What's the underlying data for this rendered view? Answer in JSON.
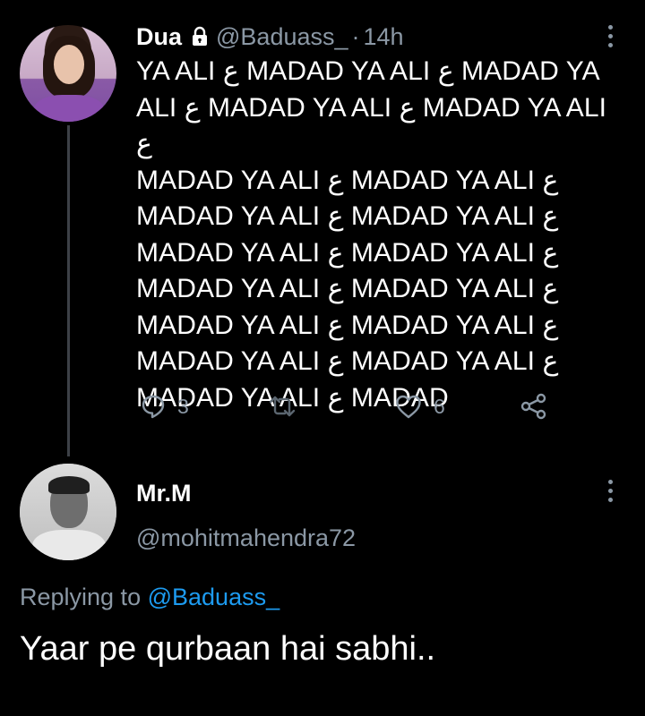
{
  "tweet": {
    "author": {
      "display_name": "Dua",
      "handle": "@Baduass_",
      "protected_icon": "lock-icon",
      "avatar": "avatar"
    },
    "separator": "·",
    "time": "14h",
    "text_lines": [
      "YA ALI ع MADAD YA ALI ع MADAD YA",
      "ALI ع MADAD YA ALI ع MADAD YA ALI ع",
      "MADAD YA ALI ع MADAD YA ALI ع",
      "MADAD YA ALI ع MADAD YA ALI ع",
      "MADAD YA ALI ع MADAD YA ALI ع",
      "MADAD YA ALI ع MADAD YA ALI ع",
      "MADAD YA ALI ع MADAD YA ALI ع",
      "MADAD YA ALI ع MADAD YA ALI ع",
      "MADAD YA ALI ع MADAD"
    ],
    "actions": {
      "reply": {
        "icon": "reply-icon",
        "count": "3"
      },
      "retweet": {
        "icon": "retweet-icon",
        "count": ""
      },
      "like": {
        "icon": "heart-icon",
        "count": "6"
      },
      "share": {
        "icon": "share-icon",
        "count": ""
      }
    },
    "more_icon": "more-vertical-icon"
  },
  "reply": {
    "author": {
      "display_name": "Mr.M",
      "handle": "@mohitmahendra72",
      "avatar": "avatar"
    },
    "replying_to_label": "Replying to",
    "replying_to_handle": "@Baduass_",
    "text": "Yaar pe qurbaan hai sabhi..",
    "more_icon": "more-vertical-icon"
  },
  "colors": {
    "background": "#000000",
    "primary_text": "#ffffff",
    "secondary_text": "#8b98a5",
    "link": "#1d9bf0",
    "thread_line": "#3d4147"
  }
}
